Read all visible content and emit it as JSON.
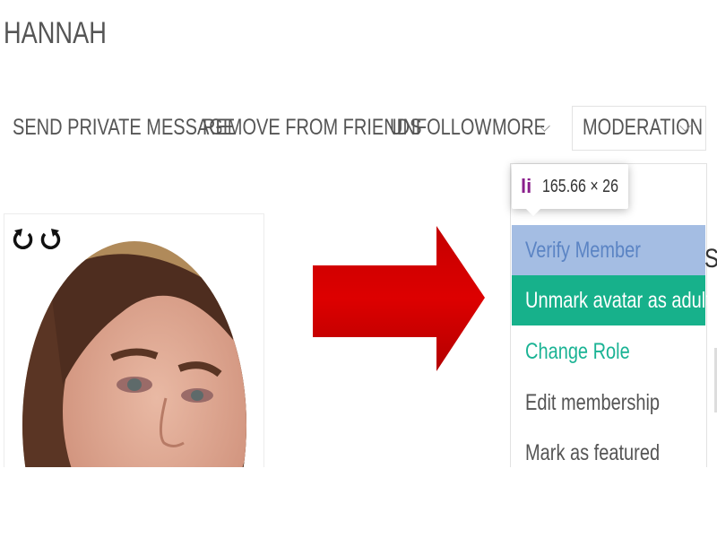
{
  "profile": {
    "username": "HANNAH"
  },
  "actions": {
    "send_message": "SEND PRIVATE MESSAGE",
    "remove_friends": "REMOVE FROM FRIENDS",
    "unfollow": "UNFOLLOW",
    "more": "MORE",
    "moderation": "MODERATION"
  },
  "devtools_tooltip": {
    "tag": "li",
    "size": "165.66 × 26"
  },
  "moderation_menu": {
    "items": [
      {
        "label": "Verify Member",
        "state": "highlighted"
      },
      {
        "label": "Unmark avatar as adult",
        "state": "active"
      },
      {
        "label": "Change Role",
        "state": "normal"
      },
      {
        "label": "Edit membership",
        "state": "normal"
      },
      {
        "label": "Mark as featured",
        "state": "normal"
      }
    ]
  },
  "side_text": "S",
  "icons": {
    "rotate_left": "rotate-left-icon",
    "rotate_right": "rotate-right-icon",
    "arrow": "red-arrow-right-icon",
    "chevron": "chevron-down-icon"
  },
  "colors": {
    "verify_bg": "#a4bde3",
    "verify_text": "#5b84c4",
    "active_bg": "#17b18b",
    "active_text": "#ffffff",
    "teal_text": "#1ab394",
    "arrow_red": "#cc0000",
    "tooltip_tag": "#8a1f8c"
  }
}
